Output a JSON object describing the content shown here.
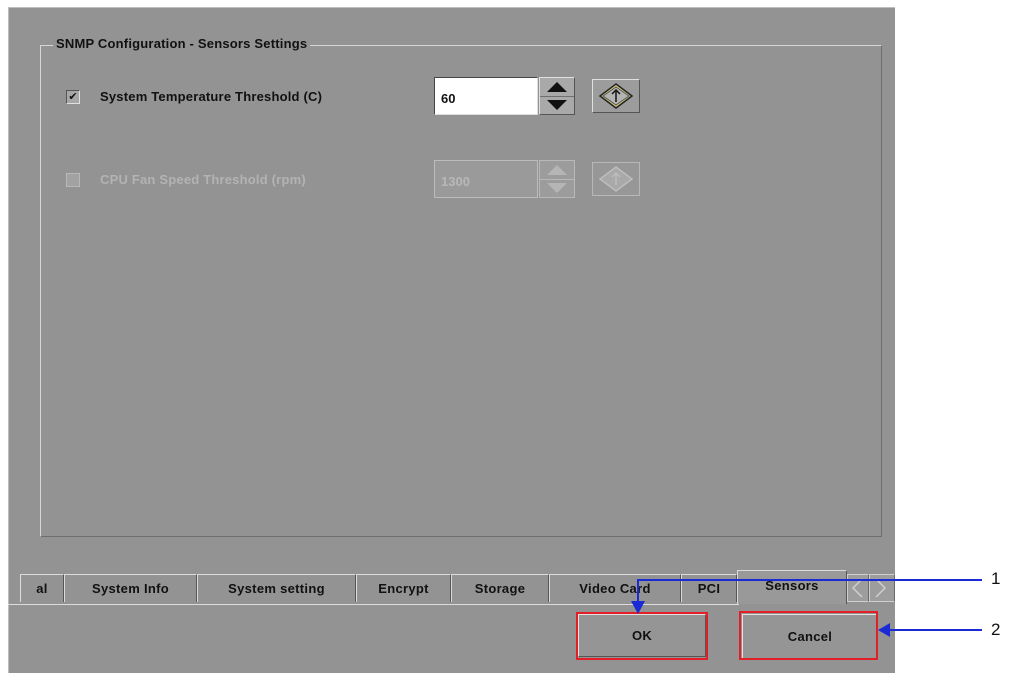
{
  "group": {
    "title": "SNMP Configuration - Sensors Settings"
  },
  "rows": [
    {
      "checked": "✔",
      "label": "System Temperature Threshold (C)",
      "value": "60",
      "enabled": true
    },
    {
      "checked": "",
      "label": "CPU Fan Speed Threshold (rpm)",
      "value": "1300",
      "enabled": false
    }
  ],
  "tabs": [
    "al",
    "System Info",
    "System setting",
    "Encrypt",
    "Storage",
    "Video Card",
    "PCI",
    "Sensors"
  ],
  "active_tab": "Sensors",
  "buttons": {
    "ok": "OK",
    "cancel": "Cancel"
  },
  "callouts": {
    "one": "1",
    "two": "2"
  },
  "colors": {
    "highlight": "#e21f26",
    "arrow": "#1a2bd6",
    "dialog_bg": "#939393"
  }
}
